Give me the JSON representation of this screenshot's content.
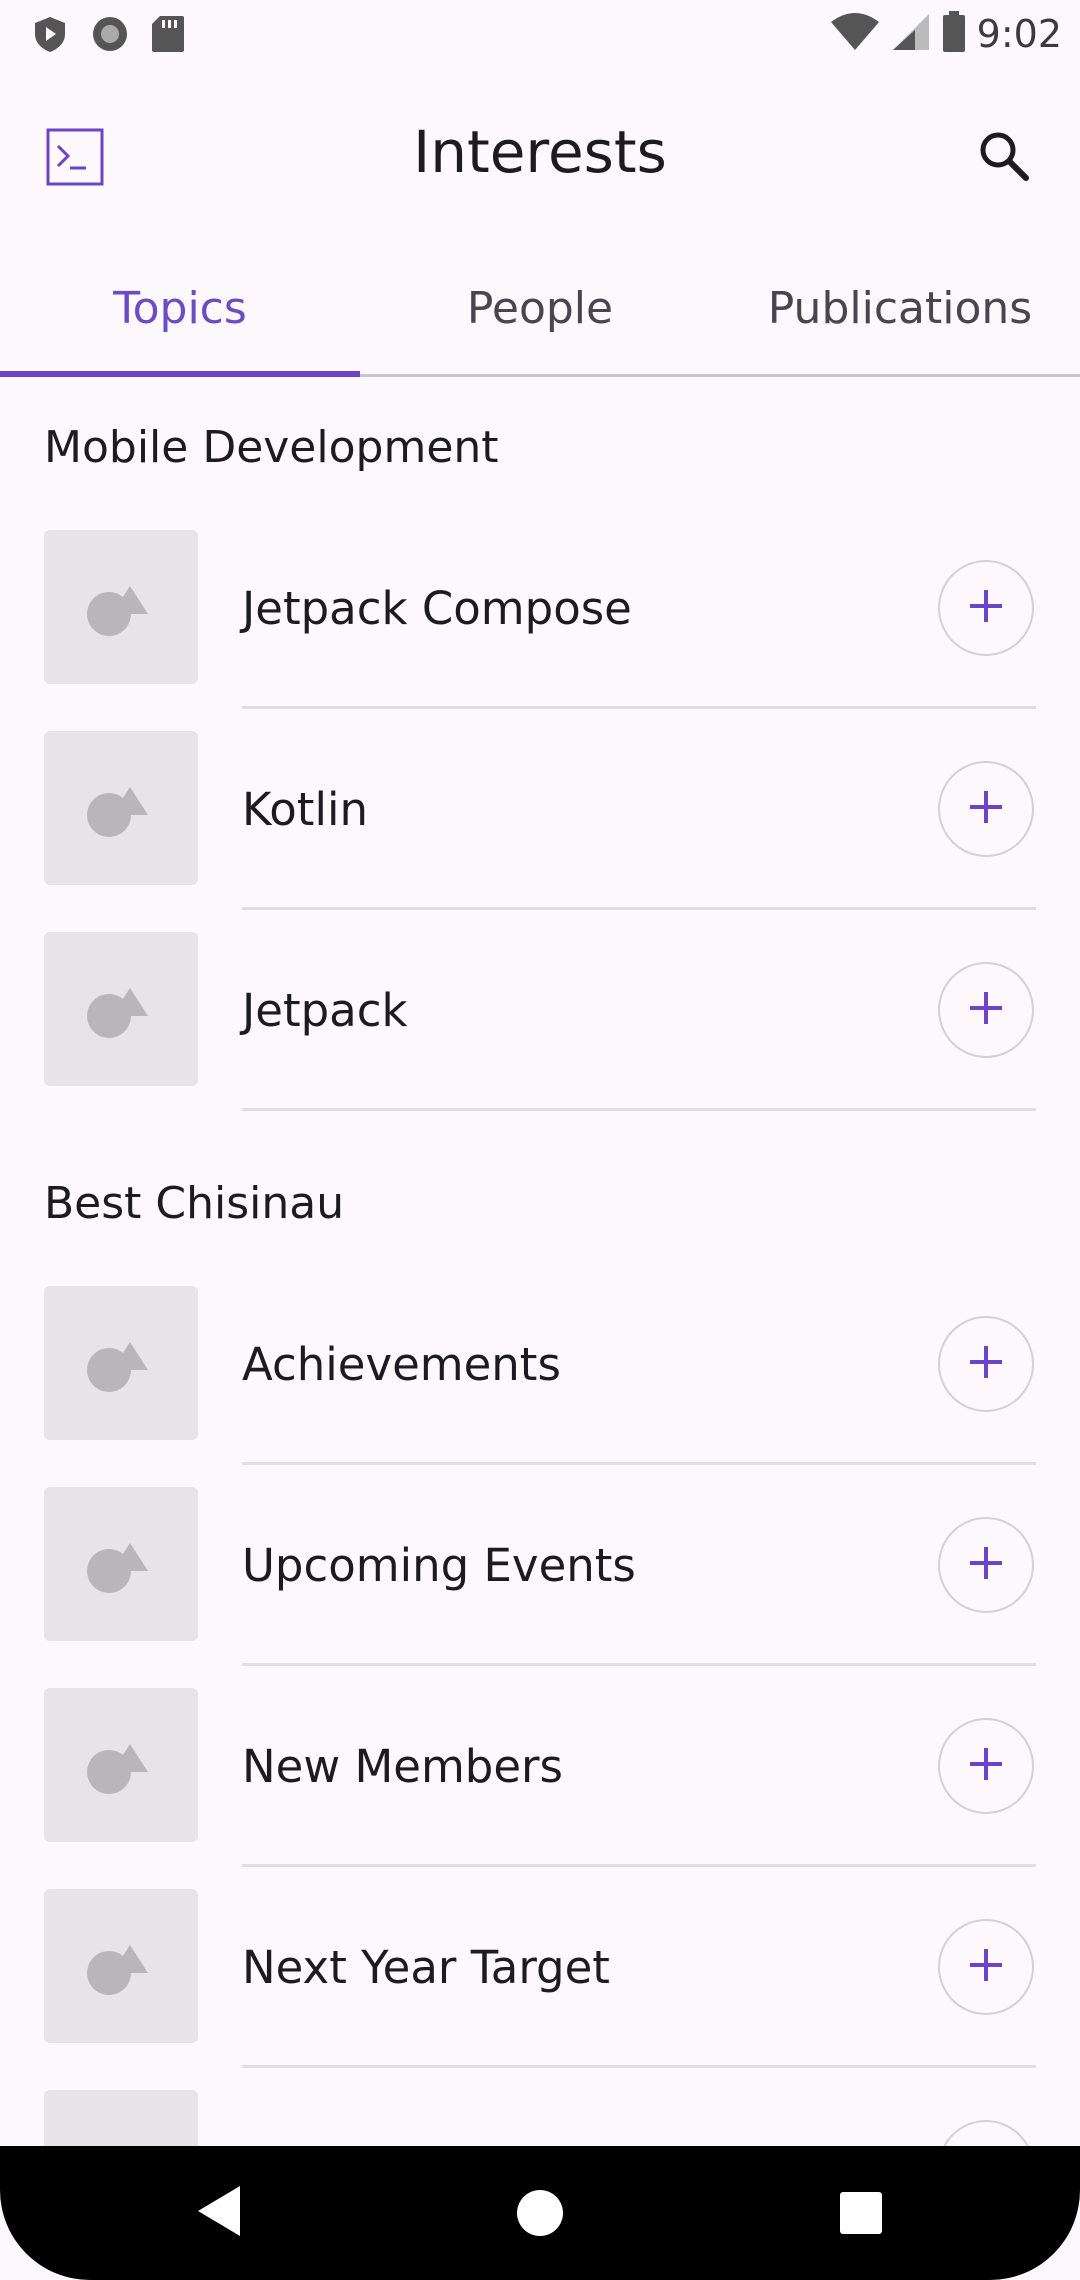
{
  "status_bar": {
    "time": "9:02",
    "left_icons": [
      "play-protect-icon",
      "record-icon",
      "sd-card-icon"
    ],
    "right_icons": [
      "wifi-icon",
      "cell-signal-icon",
      "battery-icon"
    ]
  },
  "app_bar": {
    "title": "Interests",
    "nav_icon": "terminal-icon",
    "action_icon": "search-icon"
  },
  "tabs": [
    {
      "label": "Topics",
      "selected": true
    },
    {
      "label": "People",
      "selected": false
    },
    {
      "label": "Publications",
      "selected": false
    }
  ],
  "sections": [
    {
      "title": "Mobile Development",
      "items": [
        {
          "label": "Jetpack Compose"
        },
        {
          "label": "Kotlin"
        },
        {
          "label": "Jetpack"
        }
      ]
    },
    {
      "title": "Best Chisinau",
      "items": [
        {
          "label": "Achievements"
        },
        {
          "label": "Upcoming Events"
        },
        {
          "label": "New Members"
        },
        {
          "label": "Next Year Target"
        }
      ]
    }
  ],
  "colors": {
    "accent": "#6b44c8",
    "background": "#fdf8fc",
    "thumbnail": "#e6e4e7"
  },
  "nav_bar": {
    "icons": [
      "back-icon",
      "home-icon",
      "recents-icon"
    ]
  }
}
